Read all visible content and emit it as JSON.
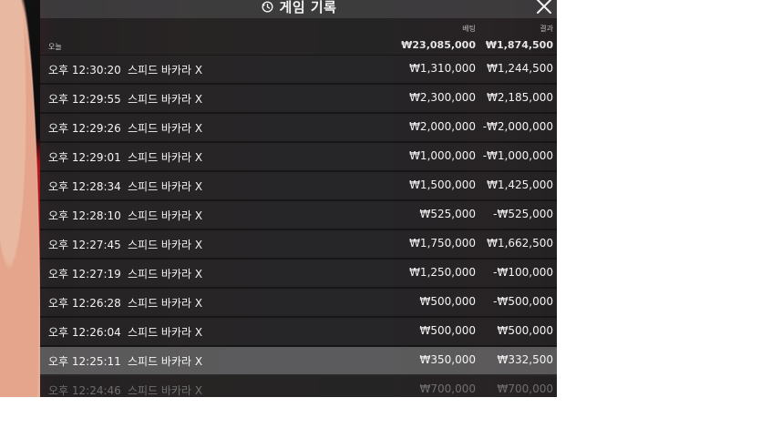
{
  "header": {
    "title": "게임 기록",
    "history_icon": "history-icon",
    "close_icon": "close-icon"
  },
  "columns": {
    "bet": "베팅",
    "result": "결과"
  },
  "summary": {
    "label": "오늘",
    "bet_total": "₩23,085,000",
    "result_total": "₩1,874,500"
  },
  "rows": [
    {
      "time": "오후 12:30:20",
      "game": "스피드 바카라 X",
      "bet": "₩1,310,000",
      "result": "₩1,244,500"
    },
    {
      "time": "오후 12:29:55",
      "game": "스피드 바카라 X",
      "bet": "₩2,300,000",
      "result": "₩2,185,000"
    },
    {
      "time": "오후 12:29:26",
      "game": "스피드 바카라 X",
      "bet": "₩2,000,000",
      "result": "-₩2,000,000"
    },
    {
      "time": "오후 12:29:01",
      "game": "스피드 바카라 X",
      "bet": "₩1,000,000",
      "result": "-₩1,000,000"
    },
    {
      "time": "오후 12:28:34",
      "game": "스피드 바카라 X",
      "bet": "₩1,500,000",
      "result": "₩1,425,000"
    },
    {
      "time": "오후 12:28:10",
      "game": "스피드 바카라 X",
      "bet": "₩525,000",
      "result": "-₩525,000"
    },
    {
      "time": "오후 12:27:45",
      "game": "스피드 바카라 X",
      "bet": "₩1,750,000",
      "result": "₩1,662,500"
    },
    {
      "time": "오후 12:27:19",
      "game": "스피드 바카라 X",
      "bet": "₩1,250,000",
      "result": "-₩100,000"
    },
    {
      "time": "오후 12:26:28",
      "game": "스피드 바카라 X",
      "bet": "₩500,000",
      "result": "-₩500,000"
    },
    {
      "time": "오후 12:26:04",
      "game": "스피드 바카라 X",
      "bet": "₩500,000",
      "result": "₩500,000"
    },
    {
      "time": "오후 12:25:11",
      "game": "스피드 바카라 X",
      "bet": "₩350,000",
      "result": "₩332,500"
    },
    {
      "time": "오후 12:24:46",
      "game": "스피드 바카라 X",
      "bet": "₩700,000",
      "result": "₩700,000"
    }
  ]
}
